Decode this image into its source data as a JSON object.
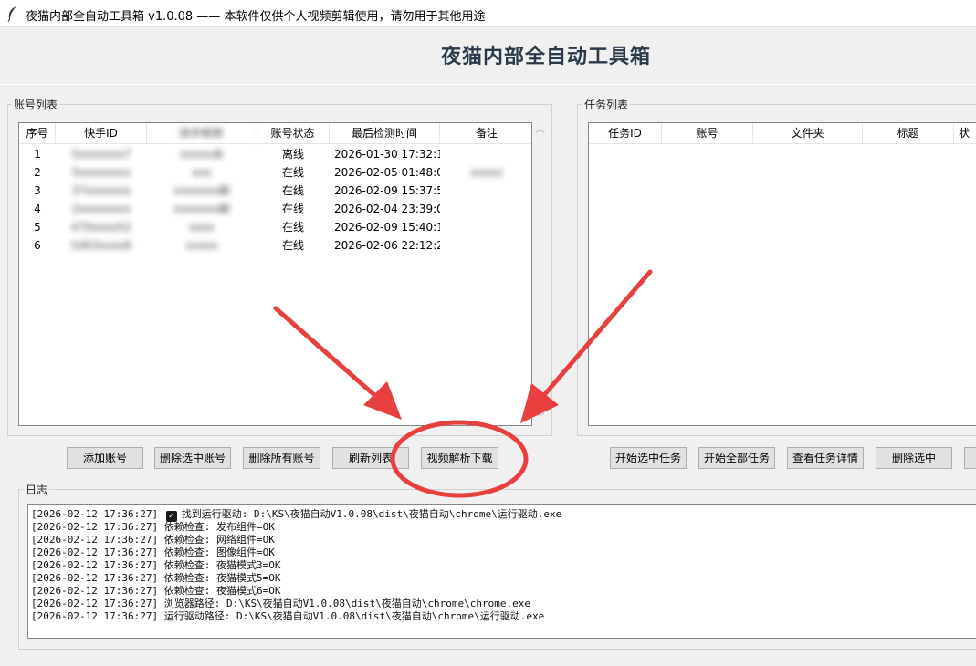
{
  "window": {
    "title": "夜猫内部全自动工具箱 v1.0.08 —— 本软件仅供个人视频剪辑使用，请勿用于其他用途"
  },
  "app": {
    "heading": "夜猫内部全自动工具箱"
  },
  "accounts_panel": {
    "label": "账号列表",
    "columns": [
      "序号",
      "快手ID",
      "快手昵称",
      "账号状态",
      "最后检测时间",
      "备注"
    ],
    "rows": [
      {
        "index": "1",
        "ks_id": "5xxxxxxx7",
        "nickname": "xxxxx米",
        "status": "离线",
        "last_check": "2026-01-30 17:32:1",
        "note": ""
      },
      {
        "index": "2",
        "ks_id": "5xxxxxxxx",
        "nickname": "xxx",
        "status": "在线",
        "last_check": "2026-02-05 01:48:0",
        "note": "xxxxx"
      },
      {
        "index": "3",
        "ks_id": "37xxxxxxx",
        "nickname": "xxxxxxx剧",
        "status": "在线",
        "last_check": "2026-02-09 15:37:5",
        "note": ""
      },
      {
        "index": "4",
        "ks_id": "2xxxxxxxx",
        "nickname": "xxxxxxx剧",
        "status": "在线",
        "last_check": "2026-02-04 23:39:0",
        "note": ""
      },
      {
        "index": "5",
        "ks_id": "470xxxx52",
        "nickname": "xxxx",
        "status": "在线",
        "last_check": "2026-02-09 15:40:1",
        "note": ""
      },
      {
        "index": "6",
        "ks_id": "5463xxxx6",
        "nickname": "xxxxx",
        "status": "在线",
        "last_check": "2026-02-06 22:12:2",
        "note": ""
      }
    ],
    "buttons": {
      "add": "添加账号",
      "delete_selected": "删除选中账号",
      "delete_all": "删除所有账号",
      "refresh": "刷新列表",
      "video_download": "视频解析下载"
    }
  },
  "tasks_panel": {
    "label": "任务列表",
    "columns": [
      "任务ID",
      "账号",
      "文件夹",
      "标题",
      "状"
    ],
    "buttons": {
      "start_selected": "开始选中任务",
      "start_all": "开始全部任务",
      "view_details": "查看任务详情",
      "delete_selected": "删除选中"
    }
  },
  "log_panel": {
    "label": "日志",
    "lines": [
      {
        "time": "[2026-02-12 17:36:27]",
        "check": true,
        "text": "找到运行驱动: D:\\KS\\夜猫自动V1.0.08\\dist\\夜猫自动\\chrome\\运行驱动.exe"
      },
      {
        "time": "[2026-02-12 17:36:27]",
        "check": false,
        "text": "依赖检查: 发布组件=OK"
      },
      {
        "time": "[2026-02-12 17:36:27]",
        "check": false,
        "text": "依赖检查: 网络组件=OK"
      },
      {
        "time": "[2026-02-12 17:36:27]",
        "check": false,
        "text": "依赖检查: 图像组件=OK"
      },
      {
        "time": "[2026-02-12 17:36:27]",
        "check": false,
        "text": "依赖检查: 夜猫模式3=OK"
      },
      {
        "time": "[2026-02-12 17:36:27]",
        "check": false,
        "text": "依赖检查: 夜猫模式5=OK"
      },
      {
        "time": "[2026-02-12 17:36:27]",
        "check": false,
        "text": "依赖检查: 夜猫模式6=OK"
      },
      {
        "time": "[2026-02-12 17:36:27]",
        "check": false,
        "text": "浏览器路径: D:\\KS\\夜猫自动V1.0.08\\dist\\夜猫自动\\chrome\\chrome.exe"
      },
      {
        "time": "[2026-02-12 17:36:27]",
        "check": false,
        "text": "运行驱动路径: D:\\KS\\夜猫自动V1.0.08\\dist\\夜猫自动\\chrome\\运行驱动.exe"
      }
    ]
  },
  "annotation": {
    "color": "#e8403f"
  }
}
